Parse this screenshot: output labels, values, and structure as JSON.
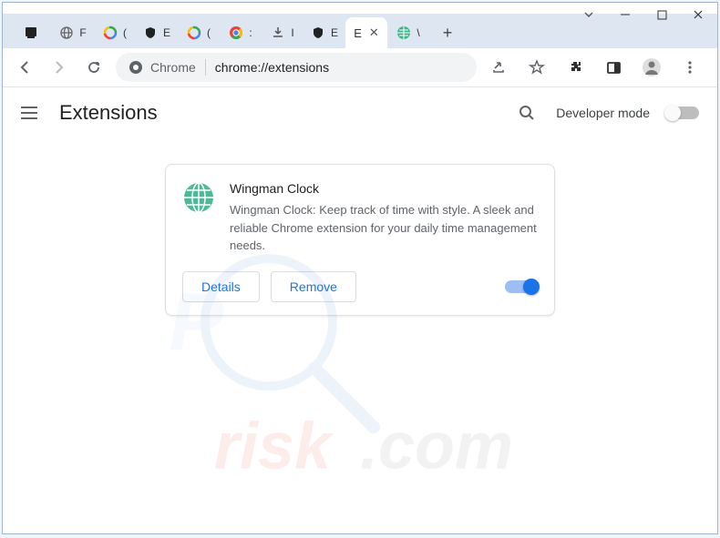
{
  "window": {
    "controls": {
      "chevron": "⌄",
      "minimize": "—",
      "maximize": "▢",
      "close": "✕"
    }
  },
  "tabs": [
    {
      "label": "",
      "icon": "printer"
    },
    {
      "label": "F",
      "icon": "globe-gray"
    },
    {
      "label": "(",
      "icon": "google"
    },
    {
      "label": "E",
      "icon": "shield"
    },
    {
      "label": "(",
      "icon": "google"
    },
    {
      "label": ":",
      "icon": "chrome"
    },
    {
      "label": "I",
      "icon": "download"
    },
    {
      "label": "E",
      "icon": "shield"
    },
    {
      "label": "E",
      "icon": "page",
      "active": true,
      "closable": true
    },
    {
      "label": "\\",
      "icon": "green-globe"
    }
  ],
  "newtab": "+",
  "toolbar": {
    "back": "←",
    "forward": "→",
    "reload": "↻",
    "omnibox": {
      "chip": "Chrome",
      "url": "chrome://extensions"
    },
    "share": "↗",
    "star": "☆",
    "puzzle": "🧩",
    "panel": "▣",
    "profile": "👤",
    "menu": "⋮"
  },
  "page": {
    "title": "Extensions",
    "dev_mode": "Developer mode"
  },
  "extension": {
    "name": "Wingman Clock",
    "description": "Wingman Clock: Keep track of time with style. A sleek and reliable Chrome extension for your daily time management needs.",
    "details_btn": "Details",
    "remove_btn": "Remove",
    "enabled": true
  },
  "watermark": "pcrisk.com"
}
